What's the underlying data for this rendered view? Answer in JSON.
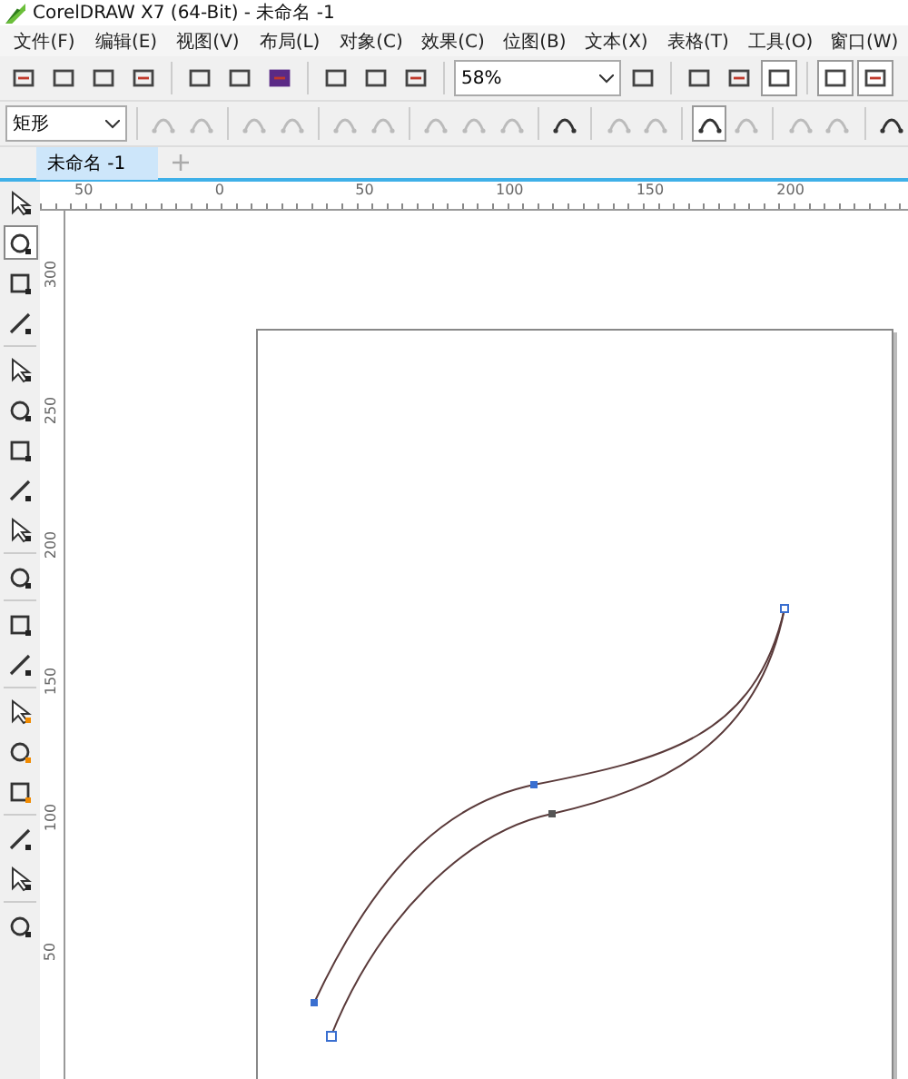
{
  "window": {
    "title": "CorelDRAW X7 (64-Bit) - 未命名 -1"
  },
  "menu": [
    "文件(F)",
    "编辑(E)",
    "视图(V)",
    "布局(L)",
    "对象(C)",
    "效果(C)",
    "位图(B)",
    "文本(X)",
    "表格(T)",
    "工具(O)",
    "窗口(W)"
  ],
  "standard_toolbar": {
    "zoom": "58%",
    "buttons": [
      {
        "pressed": false
      },
      {
        "pressed": false
      },
      {
        "pressed": false
      },
      {
        "pressed": false
      },
      {
        "pressed": false
      },
      {
        "pressed": false
      },
      {
        "pressed": false
      },
      {
        "pressed": false
      },
      {
        "pressed": false
      },
      {
        "pressed": false
      },
      {
        "pressed": false
      },
      {
        "pressed": false
      },
      {
        "pressed": false
      },
      {
        "pressed": true
      },
      {
        "pressed": true
      },
      {
        "pressed": true
      }
    ]
  },
  "property_bar": {
    "shape": "矩形",
    "buttons": [
      {
        "disabled": true,
        "pressed": false
      },
      {
        "disabled": true,
        "pressed": false
      },
      {
        "disabled": true,
        "pressed": false
      },
      {
        "disabled": true,
        "pressed": false
      },
      {
        "disabled": true,
        "pressed": false
      },
      {
        "disabled": true,
        "pressed": false
      },
      {
        "disabled": true,
        "pressed": false
      },
      {
        "disabled": true,
        "pressed": false
      },
      {
        "disabled": true,
        "pressed": false
      },
      {
        "disabled": false,
        "pressed": false
      },
      {
        "disabled": true,
        "pressed": false
      },
      {
        "disabled": true,
        "pressed": false
      },
      {
        "disabled": false,
        "pressed": true
      },
      {
        "disabled": true,
        "pressed": false
      },
      {
        "disabled": true,
        "pressed": false
      },
      {
        "disabled": true,
        "pressed": false
      },
      {
        "disabled": false,
        "pressed": false
      }
    ]
  },
  "tabs": [
    {
      "label": "未命名 -1",
      "selected": true
    }
  ],
  "toolbox": [
    {
      "selected": false
    },
    {
      "selected": true
    },
    {
      "selected": false
    },
    {
      "selected": false
    },
    {
      "selected": false
    },
    {
      "selected": false
    },
    {
      "selected": false
    },
    {
      "selected": false
    },
    {
      "selected": false
    },
    {
      "selected": false
    },
    {
      "selected": false
    },
    {
      "selected": false
    },
    {
      "selected": false
    },
    {
      "selected": false
    },
    {
      "selected": false
    },
    {
      "selected": false
    },
    {
      "selected": false
    },
    {
      "selected": false
    }
  ],
  "horizontal_ruler": [
    "50",
    "0",
    "50",
    "100",
    "150",
    "200"
  ],
  "vertical_ruler": [
    "300",
    "250",
    "200",
    "150",
    "100",
    "50"
  ]
}
